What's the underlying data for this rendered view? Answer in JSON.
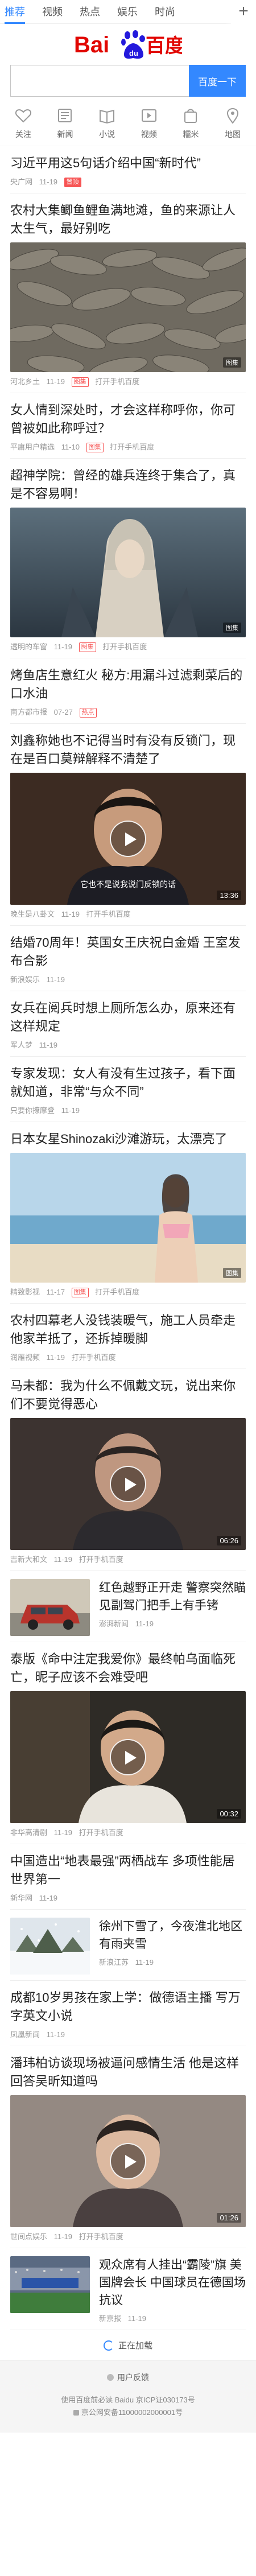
{
  "nav": {
    "tabs": [
      "推荐",
      "视频",
      "热点",
      "娱乐",
      "时尚"
    ],
    "plus": "+"
  },
  "logo": {
    "text_left": "Bai",
    "paw_text": "du",
    "text_right": "百度"
  },
  "search": {
    "placeholder": "",
    "button": "百度一下"
  },
  "quick": [
    "关注",
    "新闻",
    "小说",
    "视频",
    "糯米",
    "地图"
  ],
  "feed": [
    {
      "title": "习近平用这5句话介绍中国“新时代”",
      "source": "央广网",
      "time": "11-19",
      "tag": "置顶",
      "tag_fill": true
    },
    {
      "title": "农村大集鲫鱼鲤鱼满地滩，鱼的来源让人太生气，最好别吃",
      "source": "河北乡土",
      "time": "11-19",
      "tag": "图集",
      "tag2": "打开手机百度",
      "count": "图集"
    },
    {
      "title": "女人情到深处时，才会这样称呼你，你可曾被如此称呼过？",
      "source": "平庸用户精选",
      "time": "11-10",
      "tag": "图集",
      "tag2": "打开手机百度"
    },
    {
      "title": "超神学院：曾经的雄兵连终于集合了，真是不容易啊！",
      "source": "透明的车窗",
      "time": "11-19",
      "tag": "图集",
      "tag2": "打开手机百度",
      "count": "图集"
    },
    {
      "title": "烤鱼店生意红火 秘方:用漏斗过滤剩菜后的口水油",
      "source": "南方都市报",
      "time": "07-27",
      "tag": "热点"
    },
    {
      "title": "刘鑫称她也不记得当时有没有反锁门，现在是百口莫辩解释不清楚了",
      "source": "晚生是八卦文",
      "time": "11-19",
      "tag2": "打开手机百度",
      "duration": "13:36",
      "subtitle": "它也不是说我说门反锁的话"
    },
    {
      "title": "结婚70周年！英国女王庆祝白金婚 王室发布合影",
      "source": "新浪娱乐",
      "time": "11-19"
    },
    {
      "title": "女兵在阅兵时想上厕所怎么办，原来还有这样规定",
      "source": "军人梦",
      "time": "11-19"
    },
    {
      "title": "专家发现：女人有没有生过孩子，看下面就知道，非常“与众不同”",
      "source": "只要你撩摩登",
      "time": "11-19"
    },
    {
      "title": "日本女星Shinozaki沙滩游玩，太漂亮了",
      "source": "精致影视",
      "time": "11-17",
      "tag": "图集",
      "tag2": "打开手机百度",
      "count": "图集"
    },
    {
      "title": "农村四幕老人没钱装暖气，施工人员牵走他家羊抵了，还拆掉暖脚",
      "source": "润雁视频",
      "time": "11-19",
      "tag2": "打开手机百度"
    },
    {
      "title": "马未都：我为什么不佩戴文玩，说出来你们不要觉得恶心",
      "source": "吉新大和文",
      "time": "11-19",
      "tag2": "打开手机百度",
      "duration": "06:26"
    },
    {
      "title": "红色越野正开走 警察突然瞄见副驾门把手上有手铐",
      "source": "澎湃新闻",
      "time": "11-19"
    },
    {
      "title": "泰版《命中注定我爱你》最终帕乌面临死亡，昵子应该不会难受吧",
      "source": "非华高清剧",
      "time": "11-19",
      "tag2": "打开手机百度",
      "duration": "00:32"
    },
    {
      "title": "中国造出“地表最强”两栖战车 多项性能居世界第一",
      "source": "新华网",
      "time": "11-19"
    },
    {
      "title": "徐州下雪了，今夜淮北地区有雨夹雪",
      "source": "新浪江苏",
      "time": "11-19"
    },
    {
      "title": "成都10岁男孩在家上学：做德语主播 写万字英文小说",
      "source": "凤凰新闻",
      "time": "11-19"
    },
    {
      "title": "潘玮柏访谈现场被逼问感情生活 他是这样回答吴昕知道吗",
      "source": "世间点娱乐",
      "time": "11-19",
      "tag2": "打开手机百度",
      "duration": "01:26"
    },
    {
      "title": "观众席有人挂出“霸陵”旗 美国牌会长 中国球员在德国场抗议",
      "source": "新京报",
      "time": "11-19"
    }
  ],
  "more": "正在加载",
  "footer": {
    "feedback": "用户反馈",
    "copyright": "使用百度前必读 Baidu 京ICP证030173号",
    "beian": "京公网安备11000002000001号"
  }
}
